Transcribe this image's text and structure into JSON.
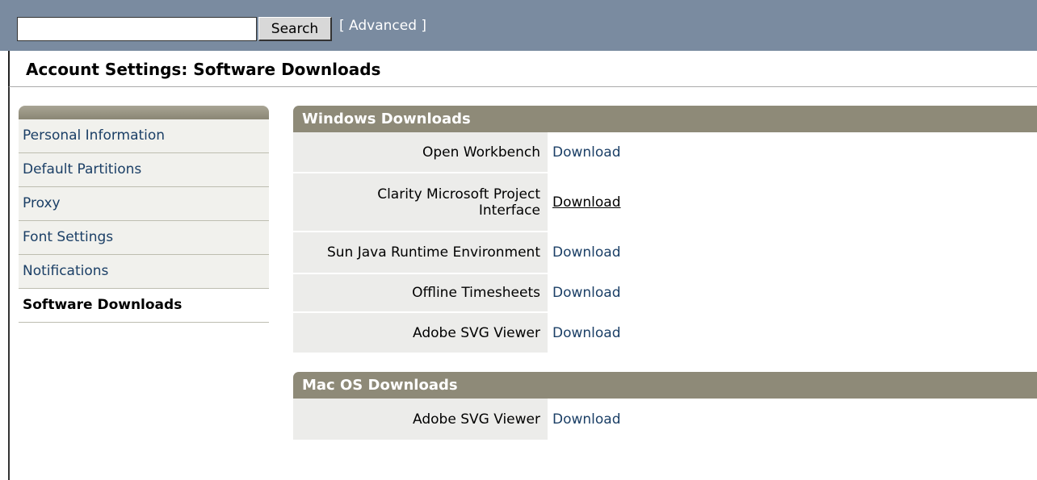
{
  "search": {
    "value": "",
    "button_label": "Search",
    "advanced_label": "[ Advanced ]"
  },
  "page": {
    "title": "Account Settings: Software Downloads"
  },
  "sidebar": {
    "items": [
      {
        "label": "Personal Information"
      },
      {
        "label": "Default Partitions"
      },
      {
        "label": "Proxy"
      },
      {
        "label": "Font Settings"
      },
      {
        "label": "Notifications"
      },
      {
        "label": "Software Downloads"
      }
    ]
  },
  "windows": {
    "header": "Windows Downloads",
    "rows": [
      {
        "label": "Open Workbench",
        "link": "Download"
      },
      {
        "label_line1": "Clarity Microsoft Project",
        "label_line2": "Interface",
        "link": "Download"
      },
      {
        "label": "Sun Java Runtime Environment",
        "link": "Download"
      },
      {
        "label": "Offline Timesheets",
        "link": "Download"
      },
      {
        "label": "Adobe SVG Viewer",
        "link": "Download"
      }
    ]
  },
  "mac": {
    "header": "Mac OS Downloads",
    "rows": [
      {
        "label": "Adobe SVG Viewer",
        "link": "Download"
      }
    ]
  }
}
